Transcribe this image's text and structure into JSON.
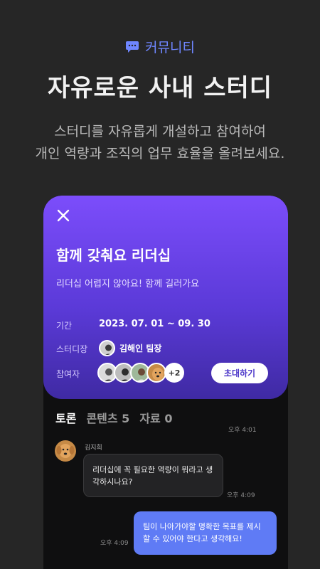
{
  "header": {
    "tag_icon": "chat-bubble-icon",
    "tag_label": "커뮤니티",
    "headline": "자유로운 사내 스터디",
    "sub_line1": "스터디를 자유롭게 개설하고 참여하여",
    "sub_line2": "개인 역량과 조직의 업무 효율을 올려보세요."
  },
  "colors": {
    "background": "#262626",
    "accent": "#6f86ff",
    "card_gradient_top": "#7c4dfb",
    "card_gradient_bottom": "#3f2aa3",
    "outgoing_bubble": "#5f7bf5"
  },
  "study_card": {
    "close_icon": "close-icon",
    "title": "함께 갖춰요 리더십",
    "description": "리더십 어렵지 않아요! 함께 길러가요",
    "period_label": "기간",
    "period_value": "2023. 07. 01 ~ 09. 30",
    "leader_label": "스터디장",
    "leader_name": "김해인 팀장",
    "members_label": "참여자",
    "members_more": "+2",
    "invite_button": "초대하기"
  },
  "tabs": [
    {
      "label": "토론",
      "active": true
    },
    {
      "label": "콘텐츠 5",
      "active": false
    },
    {
      "label": "자료 0",
      "active": false
    }
  ],
  "chat": {
    "time_top": "오후 4:01",
    "incoming": {
      "sender": "김지희",
      "text_line1": "리더십에 꼭 필요한 역량이 뭐라고 생",
      "text_line2": "각하시나요?",
      "time": "오후 4:09"
    },
    "outgoing": {
      "text_line1": "팀이 나아가야할 명확한 목표를 제시",
      "text_line2": "할 수 있어야 한다고 생각해요!",
      "time": "오후 4:09"
    }
  }
}
